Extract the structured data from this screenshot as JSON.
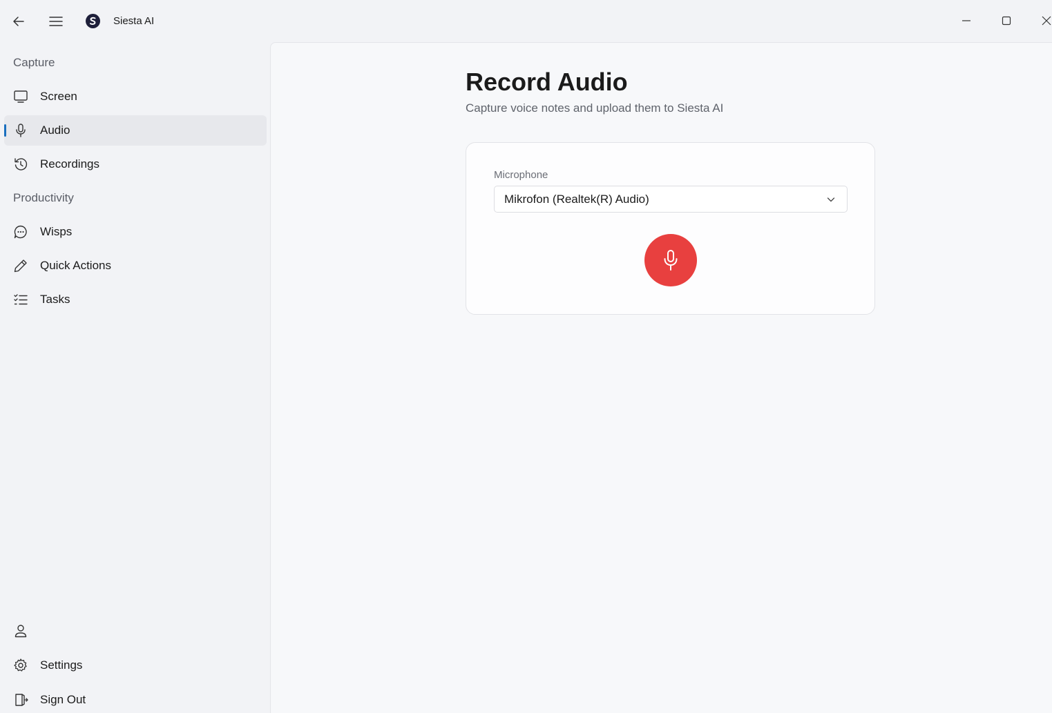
{
  "app": {
    "title": "Siesta AI",
    "logo_letter": "S"
  },
  "titlebar": {
    "icons": [
      "back-arrow-icon",
      "hamburger-menu-icon",
      "minimize-icon",
      "maximize-icon",
      "close-icon"
    ]
  },
  "sidebar": {
    "sections": [
      {
        "label": "Capture",
        "items": [
          {
            "label": "Screen",
            "icon": "monitor-icon"
          },
          {
            "label": "Audio",
            "icon": "microphone-icon",
            "active": true
          },
          {
            "label": "Recordings",
            "icon": "history-icon"
          }
        ]
      },
      {
        "label": "Productivity",
        "items": [
          {
            "label": "Wisps",
            "icon": "chat-bubble-icon"
          },
          {
            "label": "Quick Actions",
            "icon": "pencil-icon"
          },
          {
            "label": "Tasks",
            "icon": "checklist-icon"
          }
        ]
      }
    ],
    "footer": [
      {
        "label": "",
        "icon": "user-icon"
      },
      {
        "label": "Settings",
        "icon": "gear-icon"
      },
      {
        "label": "Sign Out",
        "icon": "sign-out-icon"
      }
    ]
  },
  "main": {
    "title": "Record Audio",
    "subtitle": "Capture voice notes and upload them to Siesta AI",
    "microphone": {
      "label": "Microphone",
      "selected": "Mikrofon (Realtek(R) Audio)"
    },
    "record_button_icon": "microphone-icon"
  },
  "colors": {
    "accent": "#1a6fbf",
    "record": "#e8403f",
    "logo": "#1e1f3a"
  }
}
